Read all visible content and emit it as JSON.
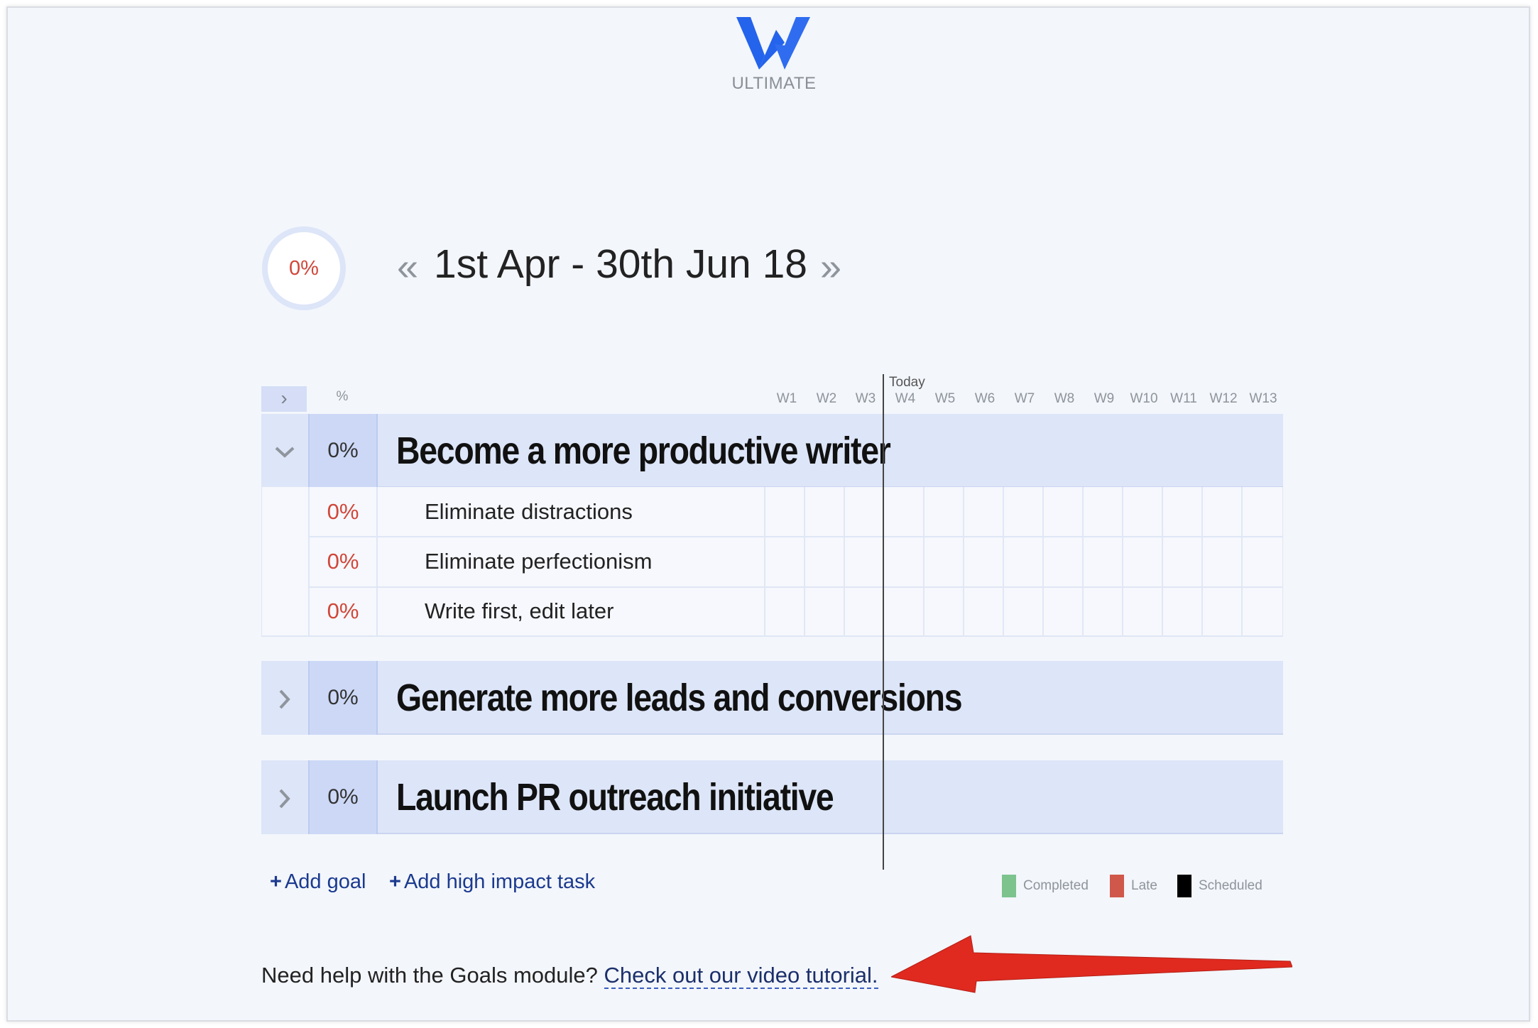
{
  "brand": {
    "name": "ULTIMATE",
    "logo_color": "#2463eb"
  },
  "header": {
    "overall_progress": "0%",
    "date_range": "1st Apr - 30th Jun 18",
    "prev_symbol": "«",
    "next_symbol": "»"
  },
  "table": {
    "expand_all_symbol": "›",
    "percent_header": "%",
    "today_label": "Today",
    "weeks": [
      "W1",
      "W2",
      "W3",
      "W4",
      "W5",
      "W6",
      "W7",
      "W8",
      "W9",
      "W10",
      "W11",
      "W12",
      "W13"
    ]
  },
  "goals": [
    {
      "toggle": "⌄",
      "progress": "0%",
      "title": "Become a more productive writer",
      "expanded": true,
      "tasks": [
        {
          "progress": "0%",
          "name": "Eliminate distractions"
        },
        {
          "progress": "0%",
          "name": "Eliminate perfectionism"
        },
        {
          "progress": "0%",
          "name": "Write first, edit later"
        }
      ]
    },
    {
      "toggle": "›",
      "progress": "0%",
      "title": "Generate more leads and conversions",
      "expanded": false
    },
    {
      "toggle": "›",
      "progress": "0%",
      "title": "Launch PR outreach initiative",
      "expanded": false
    }
  ],
  "actions": {
    "add_goal": "Add goal",
    "add_task": "Add high impact task",
    "plus": "+"
  },
  "legend": [
    {
      "label": "Completed",
      "color": "#7cc38e"
    },
    {
      "label": "Late",
      "color": "#d0584a"
    },
    {
      "label": "Scheduled",
      "color": "#000000"
    }
  ],
  "help": {
    "text": "Need help with the Goals module?",
    "link": "Check out our video tutorial."
  },
  "colors": {
    "late_red": "#d0473a",
    "annotation_arrow": "#e02a1f"
  }
}
